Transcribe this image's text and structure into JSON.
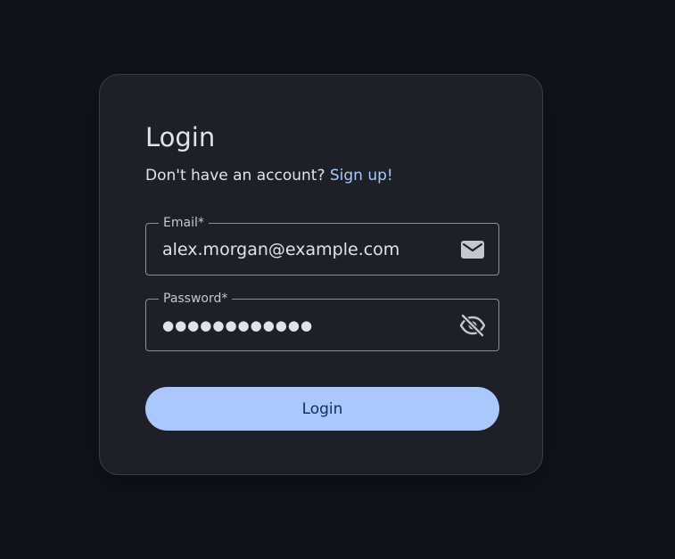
{
  "login": {
    "title": "Login",
    "signup_prompt": "Don't have an account?",
    "signup_link": "Sign up!",
    "email": {
      "label": "Email*",
      "value": "alex.morgan@example.com",
      "icon": "mail-icon"
    },
    "password": {
      "label": "Password*",
      "value": "●●●●●●●●●●●●",
      "icon": "eye-off-icon"
    },
    "submit_label": "Login"
  },
  "colors": {
    "background": "#11131a",
    "card": "#1e2028",
    "accent": "#aac7ff",
    "button_text": "#0a305f",
    "outline": "#8e9099",
    "text": "#e3e2e6"
  }
}
